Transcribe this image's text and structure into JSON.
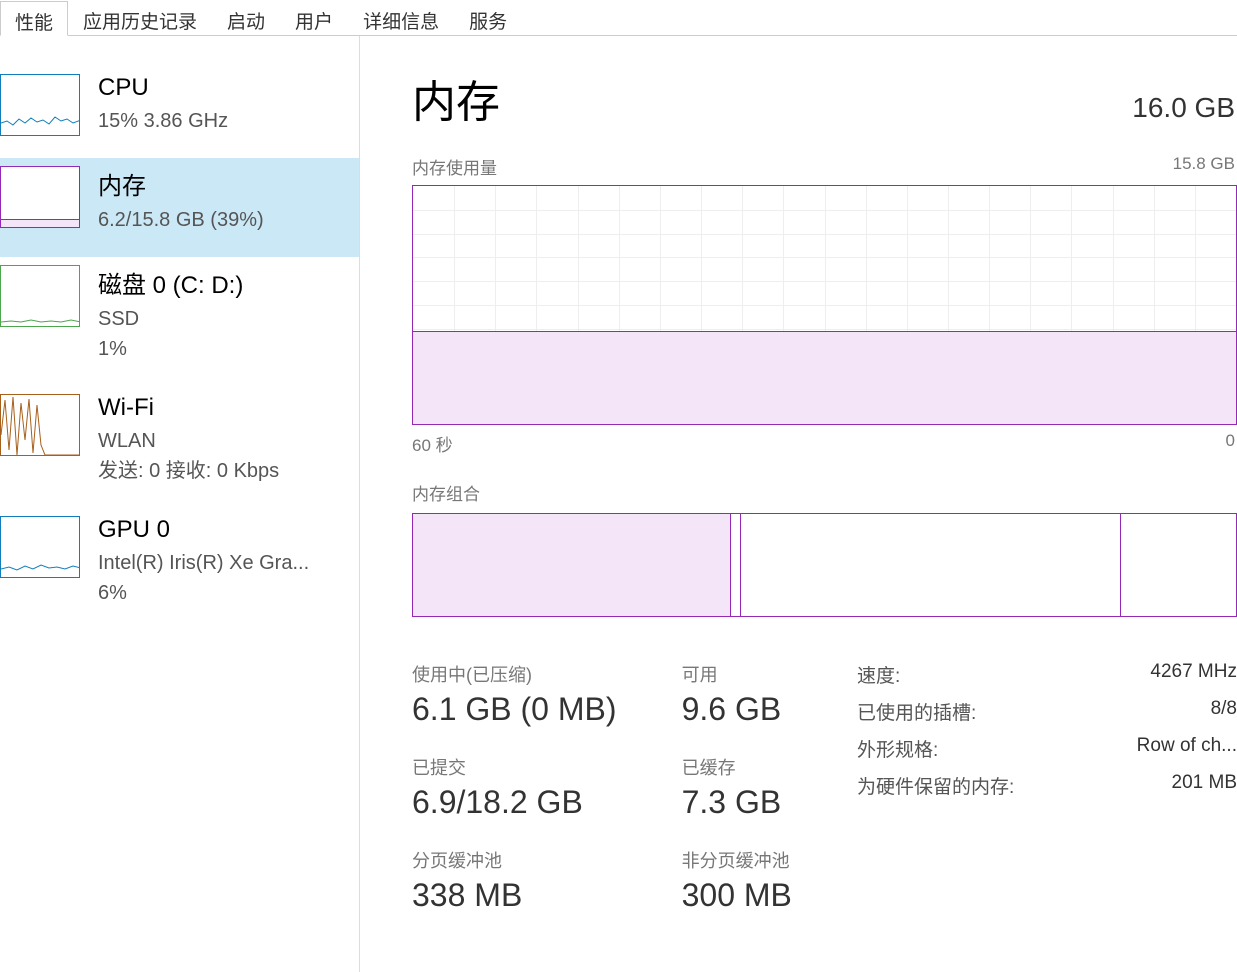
{
  "tabs": [
    "性能",
    "应用历史记录",
    "启动",
    "用户",
    "详细信息",
    "服务"
  ],
  "active_tab": 0,
  "sidebar": {
    "cpu": {
      "title": "CPU",
      "subtitle": "15% 3.86 GHz"
    },
    "memory": {
      "title": "内存",
      "subtitle": "6.2/15.8 GB (39%)"
    },
    "disk": {
      "title": "磁盘 0 (C: D:)",
      "sub1": "SSD",
      "sub2": "1%"
    },
    "wifi": {
      "title": "Wi-Fi",
      "sub1": "WLAN",
      "sub2": "发送: 0 接收: 0 Kbps"
    },
    "gpu": {
      "title": "GPU 0",
      "sub1": "Intel(R) Iris(R) Xe Gra...",
      "sub2": "6%"
    }
  },
  "main": {
    "title": "内存",
    "total": "16.0 GB",
    "usage_label": "内存使用量",
    "usage_max": "15.8 GB",
    "xaxis_left": "60 秒",
    "xaxis_right": "0",
    "composition_label": "内存组合",
    "stats": {
      "inuse_label": "使用中(已压缩)",
      "inuse_value": "6.1 GB (0 MB)",
      "available_label": "可用",
      "available_value": "9.6 GB",
      "committed_label": "已提交",
      "committed_value": "6.9/18.2 GB",
      "cached_label": "已缓存",
      "cached_value": "7.3 GB",
      "paged_label": "分页缓冲池",
      "paged_value": "338 MB",
      "nonpaged_label": "非分页缓冲池",
      "nonpaged_value": "300 MB"
    },
    "specs": {
      "speed_label": "速度:",
      "speed_value": "4267 MHz",
      "slots_label": "已使用的插槽:",
      "slots_value": "8/8",
      "form_label": "外形规格:",
      "form_value": "Row of ch...",
      "reserved_label": "为硬件保留的内存:",
      "reserved_value": "201 MB"
    }
  },
  "chart_data": {
    "type": "area",
    "title": "内存使用量",
    "ylabel": "GB",
    "ylim": [
      0,
      15.8
    ],
    "xlabel": "秒",
    "xlim": [
      60,
      0
    ],
    "series": [
      {
        "name": "使用中",
        "approx_value": 6.2
      }
    ],
    "composition": {
      "type": "bar",
      "title": "内存组合",
      "segments_gb": {
        "in_use": 6.1,
        "modified": 0.1,
        "standby": 7.3,
        "free": 2.3
      },
      "total_gb": 15.8
    }
  }
}
